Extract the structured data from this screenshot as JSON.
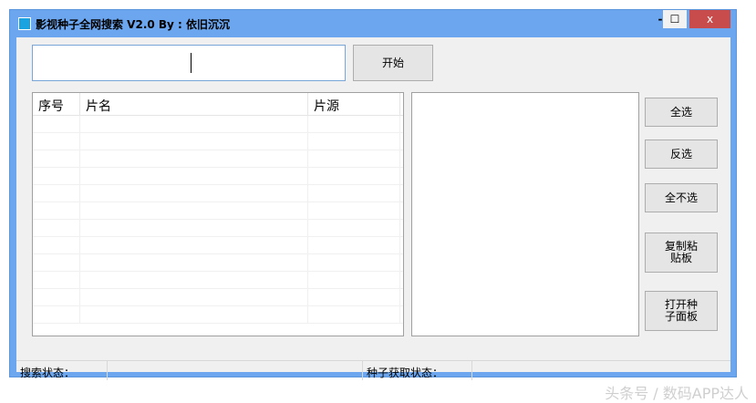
{
  "window": {
    "title": "影视种子全网搜索 V2.0 By : 依旧沉沉",
    "minimize": "-",
    "maximize": "☐",
    "close": "x"
  },
  "search": {
    "value": "",
    "start_label": "开始"
  },
  "list": {
    "columns": [
      "序号",
      "片名",
      "片源"
    ],
    "rows": 12
  },
  "buttons": {
    "select_all": "全选",
    "invert": "反选",
    "select_none": "全不选",
    "copy": "复制粘贴板",
    "open": "打开种子面板"
  },
  "status": {
    "search_label": "搜索状态：",
    "search_value": "",
    "torrent_label": "种子获取状态：",
    "torrent_value": ""
  },
  "watermark": "头条号 / 数码APP达人"
}
